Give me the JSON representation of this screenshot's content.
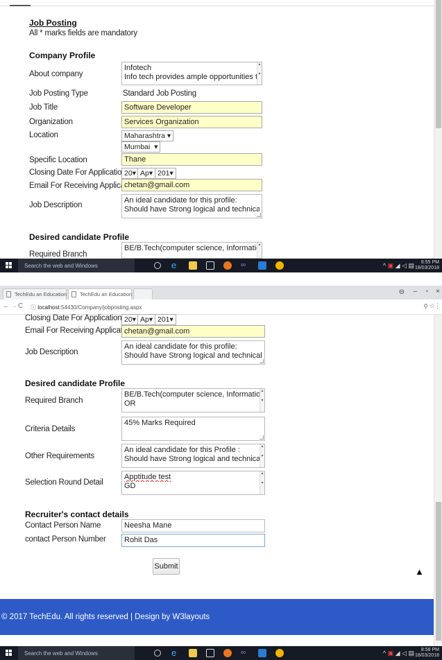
{
  "shot1": {
    "title": "Job Posting",
    "mandatory_note": "All * marks fields are mandatory",
    "company_profile_heading": "Company Profile",
    "labels": {
      "about": "About company",
      "type": "Job Posting Type",
      "title": "Job Title",
      "org": "Organization",
      "location": "Location",
      "specific": "Specific Location",
      "closing": "Closing Date For Applications",
      "email": "Email For Receiving Application",
      "desc": "Job  Description"
    },
    "values": {
      "about_line1": "Infotech",
      "about_line2": "Info tech provides ample opportunities to grow with in",
      "type": "Standard  Job Posting",
      "title": "Software Developer",
      "org": "Services Organization",
      "state": "Maharashtra",
      "city": "Mumbai",
      "specific": "Thane",
      "day": "20",
      "month": "Ap",
      "year": "201",
      "email": "chetan@gmail.com",
      "desc_line1": "An ideal candidate for this profile:",
      "desc_line2": "Should have Strong logical and technical bent of mind"
    },
    "desired_heading": "Desired candidate Profile",
    "required_branch_label": "Required Branch",
    "required_branch_value": "BE/B.Tech(computer science, Information technology)"
  },
  "taskbar1": {
    "search_placeholder": "Search the web and Windows",
    "time": "8:55 PM",
    "date": "18/03/2018"
  },
  "browser": {
    "tab1": "TechEdu an Education C",
    "tab2": "TechEdu an Education C",
    "url_host": "localhost",
    "url_rest": ":54430/Company/jobposting.aspx"
  },
  "shot2": {
    "labels": {
      "closing": "Closing Date For Applications",
      "email": "Email For Receiving Application",
      "desc": "Job  Description",
      "branch": "Required Branch",
      "criteria": "Criteria Details",
      "other": "Other Requirements",
      "selection": "Selection Round Detail",
      "contact_name": "Contact Person Name",
      "contact_number": "contact Person Number"
    },
    "values": {
      "day": "20",
      "month": "Ap",
      "year": "201",
      "email": "chetan@gmail.com",
      "desc_line1": "An ideal candidate for this profile:",
      "desc_line2": "Should have Strong logical and technical bent of mind",
      "branch_line1": "BE/B.Tech(computer science, Information technology)",
      "branch_line2": "OR",
      "criteria": "45% Marks Required",
      "other_line1": "An ideal candidate for this Profile :",
      "other_line2": "Should have Strong logical and technical bent of",
      "selection_line1": "Apptitude test",
      "selection_line2": "GD",
      "contact_name": "Neesha Mane",
      "contact_number": "Rohit Das"
    },
    "desired_heading": "Desired candidate Profile",
    "recruiter_heading": "Recruiter's  contact details",
    "submit_label": "Submit",
    "footer_text": "© 2017 TechEdu. All rights reserved | Design by W3layouts"
  },
  "taskbar2": {
    "search_placeholder": "Search the web and Windows",
    "time": "8:58 PM",
    "date": "18/03/2018"
  },
  "colors": {
    "footer_blue": "#2d5ac6",
    "highlight_yellow": "#ffffc8",
    "taskbar": "#151a24"
  }
}
